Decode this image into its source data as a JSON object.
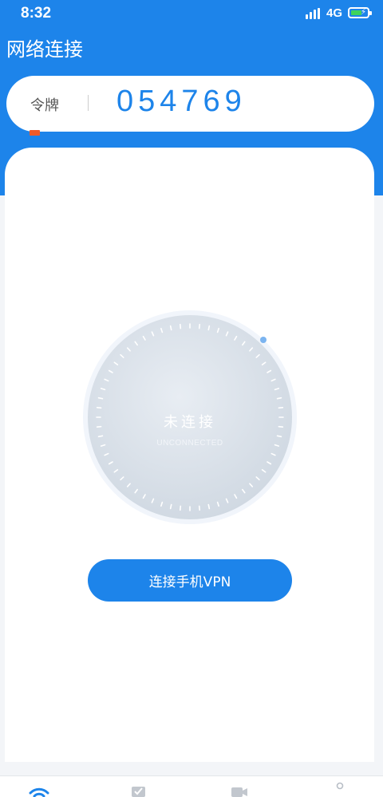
{
  "status_bar": {
    "time": "8:32",
    "network": "4G",
    "icons": [
      "signal-icon",
      "battery-charging-icon"
    ]
  },
  "header": {
    "title": "网络连接"
  },
  "token": {
    "label": "令牌",
    "value": "054769"
  },
  "connection": {
    "status": "未连接",
    "status_en": "UNCONNECTED",
    "icon": "wifi-icon"
  },
  "actions": {
    "connect_label": "连接手机VPN"
  },
  "bottom_nav": {
    "icons": [
      "wifi-icon",
      "check-icon",
      "video-icon",
      "user-icon"
    ]
  },
  "colors": {
    "accent": "#1d84ea",
    "marker": "#f05a28",
    "battery": "#3fd35c"
  }
}
